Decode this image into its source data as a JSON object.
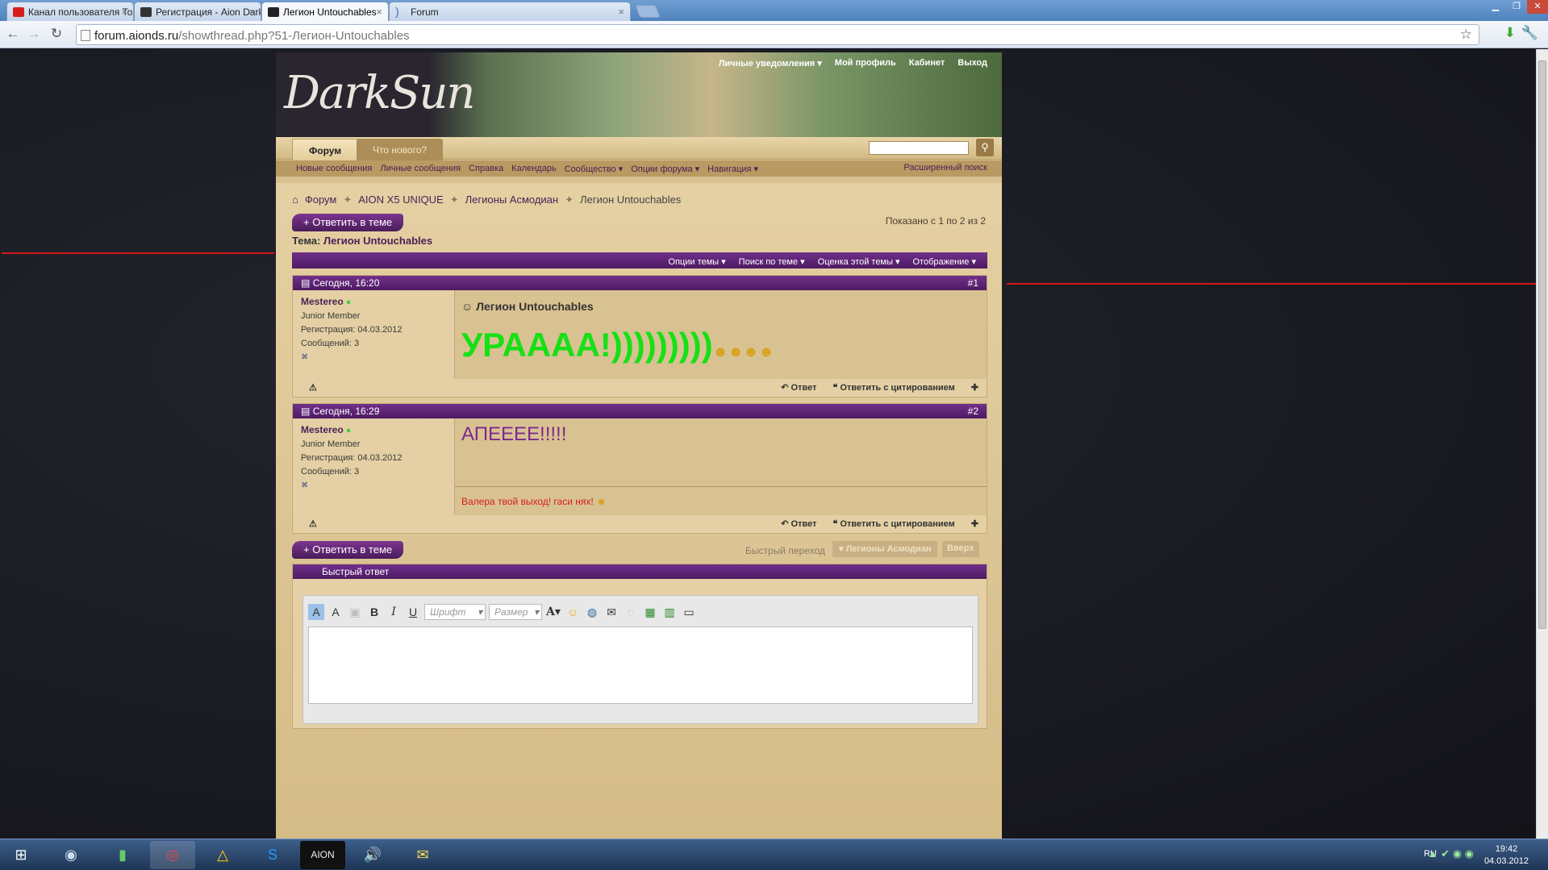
{
  "browser": {
    "tabs": [
      {
        "title": "Канал пользователя Toxic",
        "color": "#d91d1d"
      },
      {
        "title": "Регистрация - Aion DarkSu",
        "color": "#333333"
      },
      {
        "title": "Легион Untouchables",
        "color": "#222222"
      },
      {
        "title": "Forum",
        "color": "#3b6db5"
      }
    ],
    "url_host": "forum.aionds.ru",
    "url_path": "/showthread.php?51-Легион-Untouchables"
  },
  "site": {
    "logo": "DarkSun",
    "top_links": [
      "Личные уведомления ▾",
      "Мой профиль",
      "Кабинет",
      "Выход"
    ],
    "nav_tabs": [
      "Форум",
      "Что нового?"
    ],
    "subnav": [
      "Новые сообщения",
      "Личные сообщения",
      "Справка",
      "Календарь",
      "Сообщество ▾",
      "Опции форума ▾",
      "Навигация ▾"
    ],
    "advanced_search": "Расширенный поиск"
  },
  "thread": {
    "breadcrumb": [
      "Форум",
      "AION X5 UNIQUE",
      "Легионы Асмодиан",
      "Легион Untouchables"
    ],
    "reply_button": "+ Ответить в теме",
    "shown": "Показано с 1 по 2 из 2",
    "title_label": "Тема:",
    "title": "Легион Untouchables",
    "tools": [
      "Опции темы ▾",
      "Поиск по теме ▾",
      "Оценка этой темы ▾",
      "Отображение ▾"
    ],
    "quick_nav_label": "Быстрый переход",
    "quick_nav_value": "▾ Легионы Асмодиан",
    "top_button": "Вверх"
  },
  "posts": [
    {
      "date": "Сегодня, 16:20",
      "number": "#1",
      "user": "Mestereo",
      "rank": "Junior Member",
      "reg_label": "Регистрация:",
      "reg_date": "04.03.2012",
      "msgs_label": "Сообщений:",
      "msgs": "3",
      "title": "Легион Untouchables",
      "text": "УРАААА!)))))))))",
      "signature": ""
    },
    {
      "date": "Сегодня, 16:29",
      "number": "#2",
      "user": "Mestereo",
      "rank": "Junior Member",
      "reg_label": "Регистрация:",
      "reg_date": "04.03.2012",
      "msgs_label": "Сообщений:",
      "msgs": "3",
      "title": "",
      "text": "АПЕЕЕЕ!!!!!",
      "signature": "Валера твой выход! гаси нях!"
    }
  ],
  "post_actions": {
    "reply": "Ответ",
    "quote": "Ответить с цитированием"
  },
  "quick_reply": {
    "title": "Быстрый ответ",
    "font_placeholder": "Шрифт",
    "size_placeholder": "Размер"
  },
  "taskbar": {
    "lang": "RU",
    "time": "19:42",
    "date": "04.03.2012"
  },
  "colors": {
    "accent_purple": "#5e2473",
    "bg_parchment": "#dcc497",
    "green_text": "#16e016"
  }
}
